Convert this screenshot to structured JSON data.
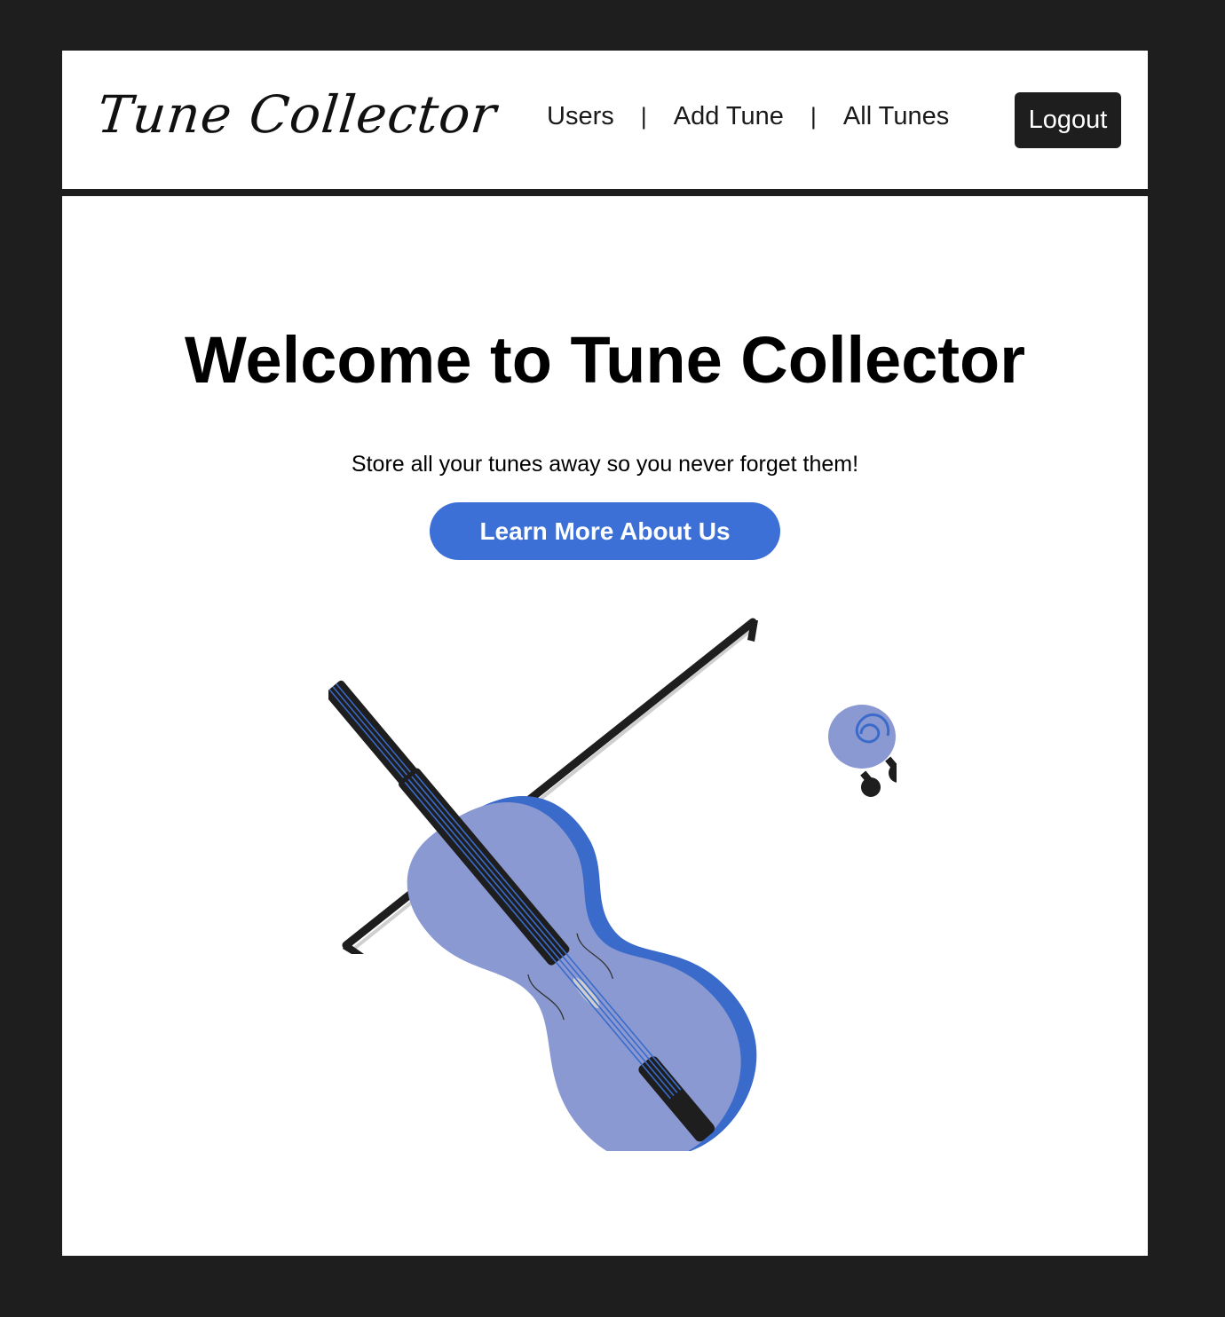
{
  "navbar": {
    "brand": "Tune Collector",
    "links": [
      "Users",
      "Add Tune",
      "All Tunes"
    ],
    "separator": "|",
    "logout_label": "Logout"
  },
  "hero": {
    "title": "Welcome to Tune Collector",
    "subtitle": "Store all your tunes away so you never forget them!",
    "cta_label": "Learn More About Us"
  },
  "illustration": {
    "icon": "violin-icon"
  },
  "colors": {
    "background": "#1e1e1e",
    "page": "#ffffff",
    "accent": "#3d70d6",
    "violin_light": "#8a99d1",
    "violin_dark": "#3a6bcb",
    "dark": "#1e1e1e"
  }
}
